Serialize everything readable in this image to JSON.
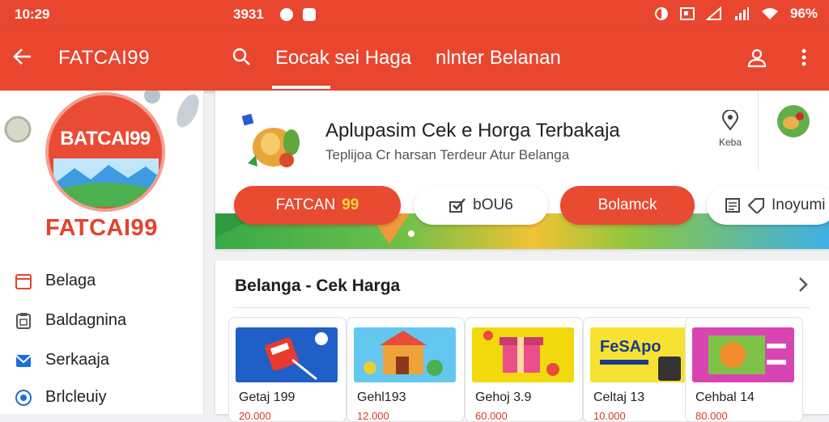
{
  "status_bar": {
    "time": "10:29",
    "center_text": "3931",
    "battery": "96%"
  },
  "app_bar": {
    "title": "FATCAI99",
    "tab_active": "Eocak sei Haga",
    "tab_other": "nlnter Belanan"
  },
  "sidebar": {
    "logo_text": "BATCAI99",
    "brand": "FATCAI99",
    "items": [
      {
        "label": "Belaga",
        "icon": "calendar-icon"
      },
      {
        "label": "Baldagnina",
        "icon": "clipboard-icon"
      },
      {
        "label": "Serkaaja",
        "icon": "mail-icon"
      },
      {
        "label": "Brlcleuiy",
        "icon": "compass-icon"
      }
    ]
  },
  "hero": {
    "headline": "Aplupasim Cek e Horga Terbakaja",
    "subline": "Teplijoa Cr harsan Terdeur Atur Belanga",
    "pin_label": "Keba",
    "buttons": [
      {
        "label": "FATCAN",
        "accent": "99",
        "style": "red"
      },
      {
        "label": "bOU6",
        "style": "white",
        "icon": "check-icon"
      },
      {
        "label": "Bolamck",
        "style": "red",
        "icon": "grid-icon"
      },
      {
        "label": "Inoyumi",
        "style": "white",
        "icon": "list-icon"
      }
    ]
  },
  "section": {
    "title": "Belanga - Cek Harga",
    "cards": [
      {
        "label": "Getaj 199",
        "price": "20.000"
      },
      {
        "label": "Gehl193",
        "price": "12.000"
      },
      {
        "label": "Gehoj 3.9",
        "price": "60.000"
      },
      {
        "label": "Celtaj 13",
        "price": "10.000"
      },
      {
        "label": "Cehbal 14",
        "price": "80.000"
      }
    ],
    "card_images": [
      {
        "icon": "cosmetics-icon",
        "bg": "#1f5fc7"
      },
      {
        "icon": "store-icon",
        "bg": "#64c7ef"
      },
      {
        "icon": "giftbox-icon",
        "bg": "#f2d90d"
      },
      {
        "icon": "device-icon",
        "bg": "#f7e233",
        "text": "FeSApo"
      },
      {
        "icon": "food-icon",
        "bg": "#d845b3"
      }
    ]
  },
  "colors": {
    "brand_red": "#e9462f",
    "text_dark": "#222222",
    "accent_yellow": "#ffd43b"
  }
}
